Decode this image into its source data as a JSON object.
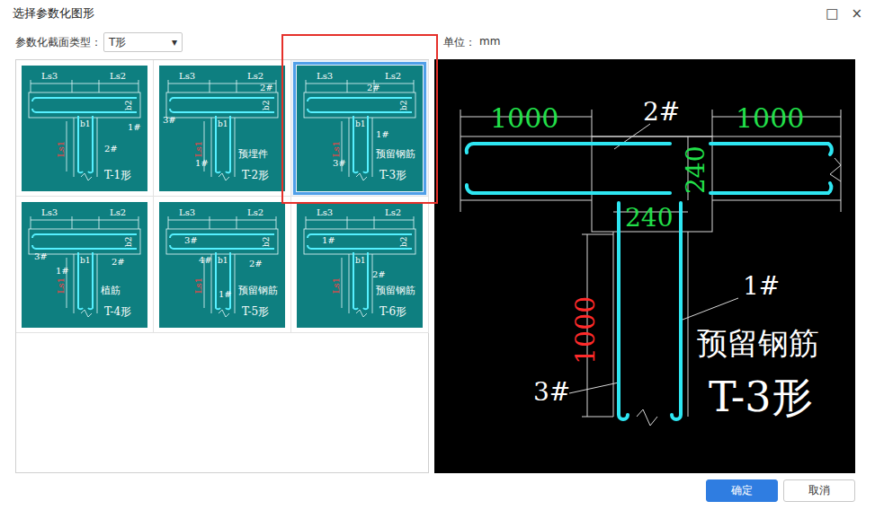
{
  "window": {
    "title": "选择参数化图形",
    "controls": [
      "□",
      "×"
    ]
  },
  "section_type": {
    "label": "参数化截面类型：",
    "value": "T形",
    "arrow": "▾"
  },
  "unit": {
    "label": "单位：",
    "value": "mm"
  },
  "thumbnails": [
    {
      "name": "T-1形",
      "note": "",
      "dims": {
        "ls3": "Ls3",
        "ls2": "Ls2",
        "b2": "b2",
        "b1": "b1",
        "ls1": "Ls1"
      },
      "marks": [
        "1#",
        "2#"
      ],
      "selected": false
    },
    {
      "name": "T-2形",
      "note": "预埋件",
      "dims": {
        "ls3": "Ls3",
        "ls2": "Ls2",
        "b2": "b2",
        "b1": "b1",
        "ls1": "Ls1"
      },
      "marks": [
        "3#",
        "2#",
        "1#"
      ],
      "selected": false
    },
    {
      "name": "T-3形",
      "note": "预留钢筋",
      "dims": {
        "ls3": "Ls3",
        "ls2": "Ls2",
        "b2": "b2",
        "b1": "b1",
        "ls1": "Ls1"
      },
      "marks": [
        "2#",
        "1#",
        "3#"
      ],
      "selected": true
    },
    {
      "name": "T-4形",
      "note": "植筋",
      "dims": {
        "ls3": "Ls3",
        "ls2": "Ls2",
        "b2": "b2",
        "b1": "b1",
        "ls1": "Ls1"
      },
      "marks": [
        "3#",
        "1#",
        "2#"
      ],
      "selected": false
    },
    {
      "name": "T-5形",
      "note": "预留钢筋",
      "dims": {
        "ls3": "Ls3",
        "ls2": "Ls2",
        "b2": "b2",
        "b1": "b1",
        "ls1": "Ls1"
      },
      "marks": [
        "3#",
        "4#",
        "2#",
        "1#"
      ],
      "selected": false
    },
    {
      "name": "T-6形",
      "note": "预留钢筋",
      "dims": {
        "ls3": "Ls3",
        "ls2": "Ls2",
        "b2": "b2",
        "b1": "b1",
        "ls1": "Ls1"
      },
      "marks": [
        "1#",
        "2#"
      ],
      "selected": false
    }
  ],
  "preview": {
    "left_length": "1000",
    "right_length": "1000",
    "flange_depth": "240",
    "web_width": "240",
    "web_length": "1000",
    "top_mark": "2#",
    "web_mark": "1#",
    "web_mark_2": "3#",
    "note": "预留钢筋",
    "name": "T-3形"
  },
  "highlight": {
    "shown": true,
    "color": "#e5302a"
  },
  "buttons": [
    {
      "label": "确定",
      "primary": true
    },
    {
      "label": "取消",
      "primary": false
    }
  ]
}
